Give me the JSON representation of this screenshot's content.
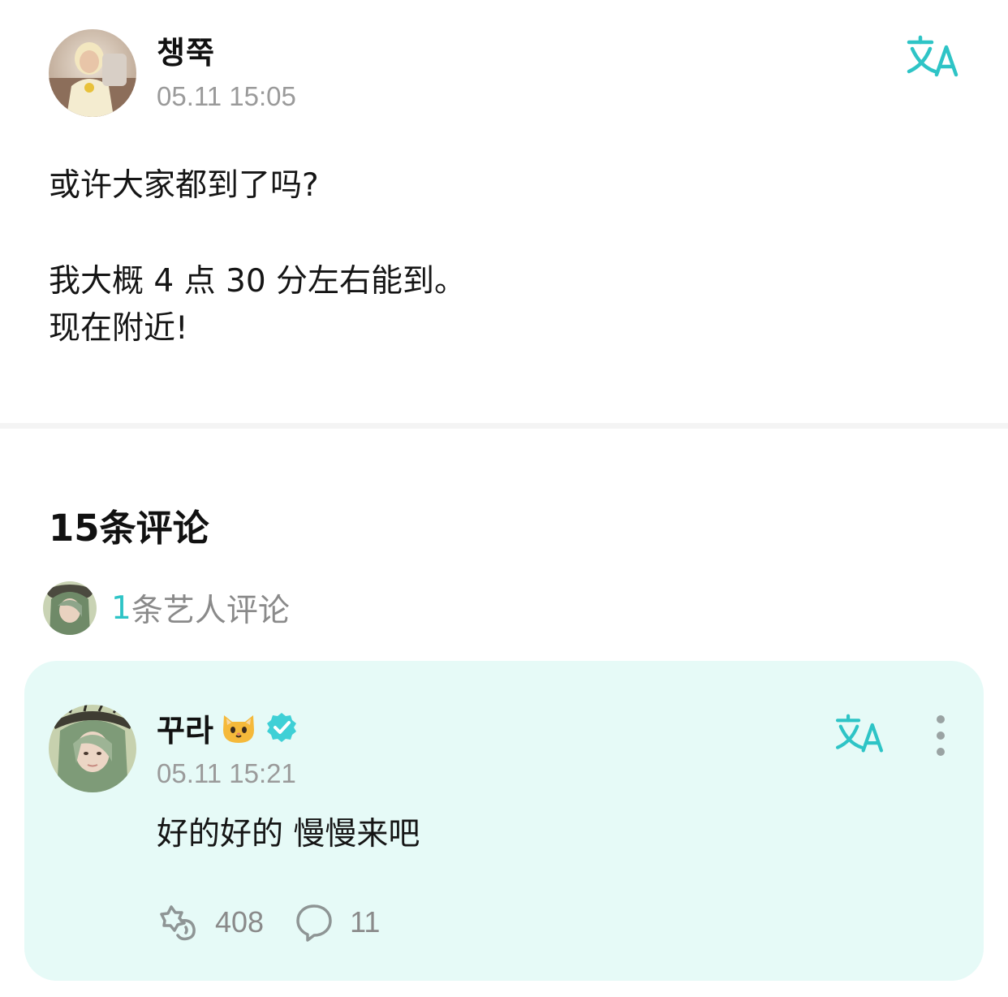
{
  "post": {
    "author": "챙쭉",
    "timestamp": "05.11 15:05",
    "lines": [
      "或许大家都到了吗?",
      "我大概 4 点 30 分左右能到。",
      "现在附近!"
    ],
    "translate_icon": "translate-icon"
  },
  "comments": {
    "count_label": "15条评论",
    "artist_comments_count": "1",
    "artist_comments_label": "条艺人评论"
  },
  "comment": {
    "author": "꾸라",
    "author_emoji_icon": "cat-face-icon",
    "verified_icon": "verified-badge-icon",
    "timestamp": "05.11 15:21",
    "text": "好的好的 慢慢来吧",
    "likes": "408",
    "replies": "11"
  },
  "colors": {
    "accent": "#2ec4c6",
    "card_background": "#e6faf7",
    "muted_text": "#9a9a9a"
  }
}
